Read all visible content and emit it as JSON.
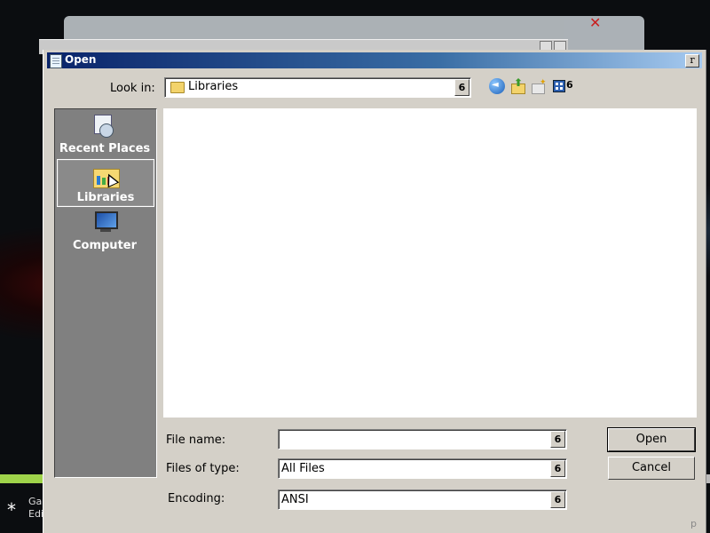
{
  "background": {
    "back_window_title": "",
    "taskbar_partial_text": [
      "Ga",
      "Edi"
    ]
  },
  "dialog": {
    "title": "Open",
    "close_label": "r",
    "look_in": {
      "label": "Look in:",
      "value": "Libraries",
      "dropdown_glyph": "6"
    },
    "toolbar": {
      "view_menu_glyph": "6"
    },
    "places": [
      {
        "label": "Recent Places",
        "icon": "recent-places-icon"
      },
      {
        "label": "Libraries",
        "icon": "libraries-icon",
        "selected": true
      },
      {
        "label": "Computer",
        "icon": "computer-icon"
      }
    ],
    "file_name": {
      "label": "File name:",
      "value": "",
      "dropdown_glyph": "6"
    },
    "file_type": {
      "label": "Files of type:",
      "value": "All Files",
      "dropdown_glyph": "6"
    },
    "encoding": {
      "label": "Encoding:",
      "value": "ANSI",
      "dropdown_glyph": "6"
    },
    "open_button": "Open",
    "cancel_button": "Cancel",
    "grip_glyph": "p"
  }
}
